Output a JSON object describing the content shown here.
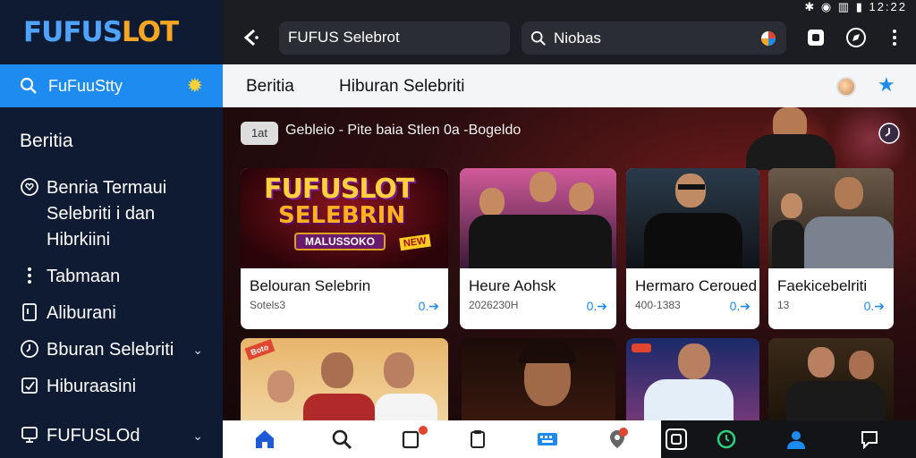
{
  "brand": {
    "part1": "FUFUS",
    "part2": "LOT",
    "accent": "#1e8bf0",
    "gold": "#f6a623"
  },
  "sidebar": {
    "search_label": "FuFuuStty",
    "heading": "Beritia",
    "items": [
      {
        "label": "Benria Termaui Selebriti i dan Hibrkiini",
        "icon": "heart-circle-icon"
      },
      {
        "label": "Tabmaan",
        "icon": "more-vertical-icon"
      },
      {
        "label": "Aliburani",
        "icon": "tablet-icon"
      },
      {
        "label": "Bburan Selebriti",
        "icon": "clock-icon",
        "chevron": true
      },
      {
        "label": "Hiburaasini",
        "icon": "edit-icon"
      },
      {
        "label": "FUFUSLOd",
        "icon": "device-icon",
        "chevron": true
      }
    ]
  },
  "topbar": {
    "status": "✱ ◉ ▥ ▮ 12:22",
    "url": "FUFUS Selebrot",
    "search": "Niobas"
  },
  "tabs": [
    "Beritia",
    "Hiburan Selebriti"
  ],
  "content": {
    "pill": "1at",
    "banner": "Gebleio  - Pite baia Stlen 0a -Bogeldo",
    "promo": {
      "line1": "FUFUSLOT",
      "line2": "SELEBRIN",
      "line3": "MALUSSOKO",
      "tag": "NEW"
    },
    "cards": [
      {
        "title": "Belouran Selebrin",
        "meta": "Sotels3",
        "arrow": "0.➔"
      },
      {
        "title": "Heure Aohsk",
        "meta": "2026230H",
        "arrow": "0.➔"
      },
      {
        "title": "Hermaro Ceroued",
        "meta": "400-1383",
        "arrow": "0.➔"
      },
      {
        "title": "Faekicebelriti",
        "meta": "13",
        "arrow": "0.➔"
      }
    ],
    "row2_tag": "Boto"
  }
}
